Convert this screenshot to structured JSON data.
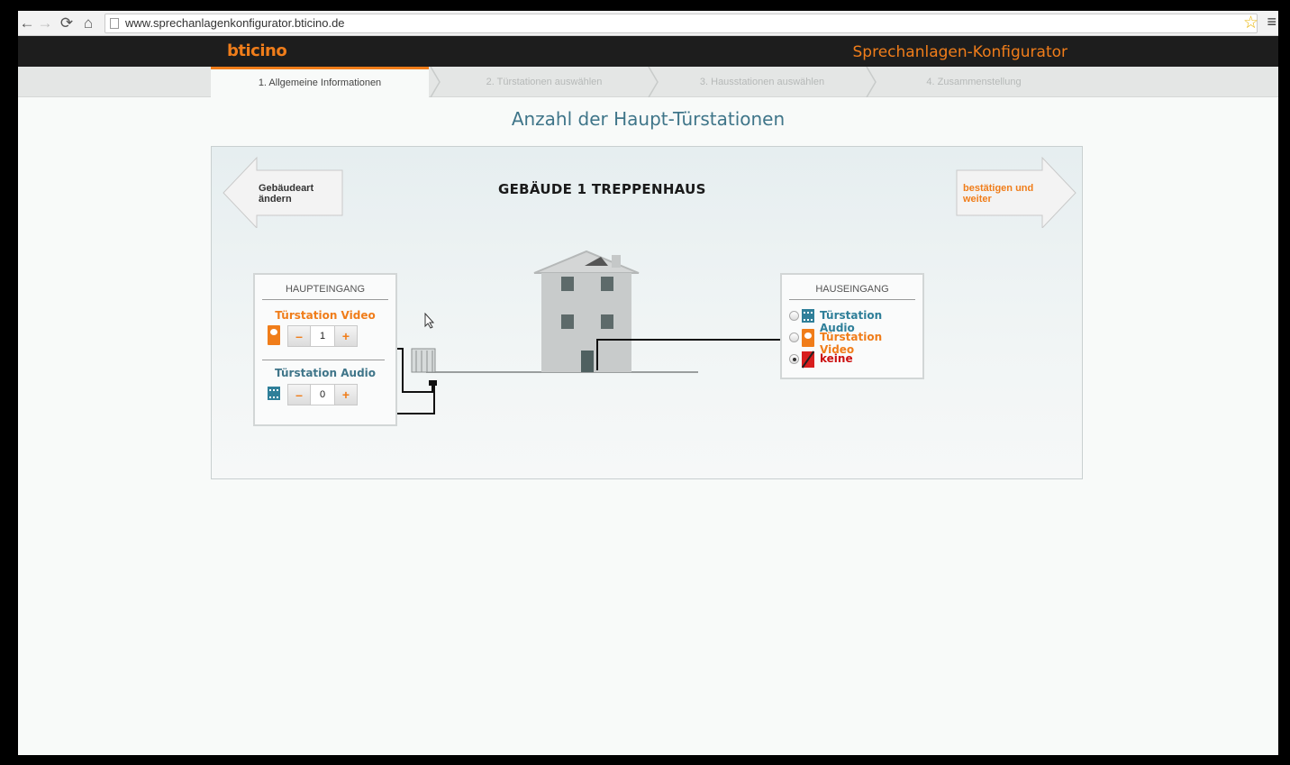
{
  "browser": {
    "url": "www.sprechanlagenkonfigurator.bticino.de"
  },
  "header": {
    "logo": "bticino",
    "app_title": "Sprechanlagen-Konfigurator"
  },
  "steps": [
    {
      "label": "1. Allgemeine Informationen",
      "active": true
    },
    {
      "label": "2. Türstationen auswählen",
      "active": false
    },
    {
      "label": "3. Hausstationen auswählen",
      "active": false
    },
    {
      "label": "4. Zusammenstellung",
      "active": false
    }
  ],
  "main": {
    "title": "Anzahl der Haupt-Türstationen",
    "building_title": "GEBÄUDE 1 TREPPENHAUS",
    "back_button": {
      "line1": "Gebäudeart",
      "line2": "ändern"
    },
    "next_button": {
      "line1": "bestätigen und",
      "line2": "weiter"
    }
  },
  "main_entrance": {
    "heading": "HAUPTEINGANG",
    "video": {
      "label": "Türstation Video",
      "value": "1",
      "minus": "–",
      "plus": "+"
    },
    "audio": {
      "label": "Türstation Audio",
      "value": "0",
      "minus": "–",
      "plus": "+"
    }
  },
  "house_entrance": {
    "heading": "HAUSEINGANG",
    "options": [
      {
        "label": "Türstation Audio",
        "checked": false
      },
      {
        "label": "Türstation Video",
        "checked": false
      },
      {
        "label": "keine",
        "checked": true
      }
    ]
  },
  "colors": {
    "accent": "#f07d1a",
    "teal": "#3f7589",
    "red": "#cc1010"
  }
}
